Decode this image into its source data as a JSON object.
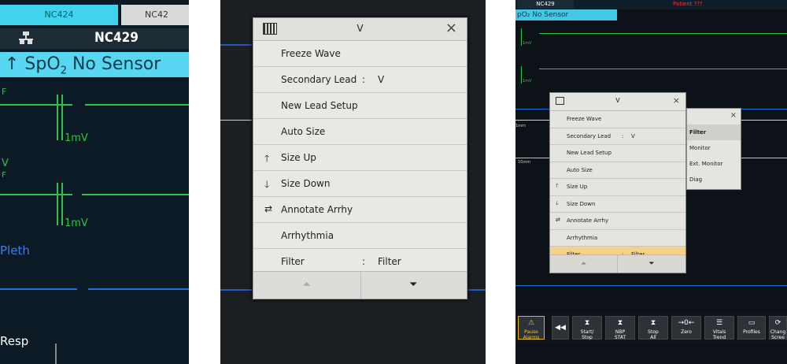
{
  "panel1": {
    "tab_active": "NC424",
    "tab_other": "NC42",
    "bed_label": "NC429",
    "alarm_text": "↑ SpO",
    "alarm_sub": "2",
    "alarm_msg": "No Sensor",
    "wave_scale_1": "1mV",
    "wave_scale_2": "1mV",
    "lead_label_1a": "F",
    "lead_label_2a": "V",
    "lead_label_2b": "F",
    "pleth_label": "Pleth",
    "resp_label": "Resp",
    "colors": {
      "alarm": "#57d7f2",
      "ecg": "#2ec24a",
      "pleth": "#1e6fd6"
    }
  },
  "menu": {
    "title": "V",
    "close": "×",
    "items": [
      {
        "label": "Freeze Wave",
        "sep": "",
        "value": "",
        "icon": ""
      },
      {
        "label": "Secondary Lead",
        "sep": ":",
        "value": "V",
        "icon": ""
      },
      {
        "label": "New Lead Setup",
        "sep": "",
        "value": "",
        "icon": ""
      },
      {
        "label": "Auto Size",
        "sep": "",
        "value": "",
        "icon": ""
      },
      {
        "label": "Size Up",
        "sep": "",
        "value": "",
        "icon": "🡑"
      },
      {
        "label": "Size Down",
        "sep": "",
        "value": "",
        "icon": "🡓"
      },
      {
        "label": "Annotate Arrhy",
        "sep": "",
        "value": "",
        "icon": "⇄"
      },
      {
        "label": "Arrhythmia",
        "sep": "",
        "value": "",
        "icon": ""
      },
      {
        "label": "Filter",
        "sep": ":",
        "value": "Filter",
        "icon": ""
      }
    ],
    "nav_up": "⏶",
    "nav_down": "⏷"
  },
  "panel3": {
    "tab": "NC429",
    "patient": "Patient ???",
    "alarm": "pO₂  No Sensor",
    "scale_1": "1mV",
    "scale_2": "1mV",
    "scale_3": "1mm",
    "scale_4": "10mm",
    "menu_title": "V",
    "submenu": [
      "Filter",
      "Monitor",
      "Ext. Monitor",
      "Diag"
    ],
    "selected_filter": "Filter",
    "buttons": [
      {
        "label": "Pause\nAlarms",
        "icon": "⚠"
      },
      {
        "label": "",
        "icon": "◀◀"
      },
      {
        "label": "Start/\nStop",
        "icon": "⧗"
      },
      {
        "label": "NBP\nSTAT",
        "icon": "⧗"
      },
      {
        "label": "Stop\nAll",
        "icon": "⧗"
      },
      {
        "label": "Zero",
        "icon": "→0←"
      },
      {
        "label": "Vitals\nTrend",
        "icon": "☰"
      },
      {
        "label": "Profiles",
        "icon": "▭"
      },
      {
        "label": "Chang\nScree",
        "icon": "⟳"
      }
    ]
  }
}
